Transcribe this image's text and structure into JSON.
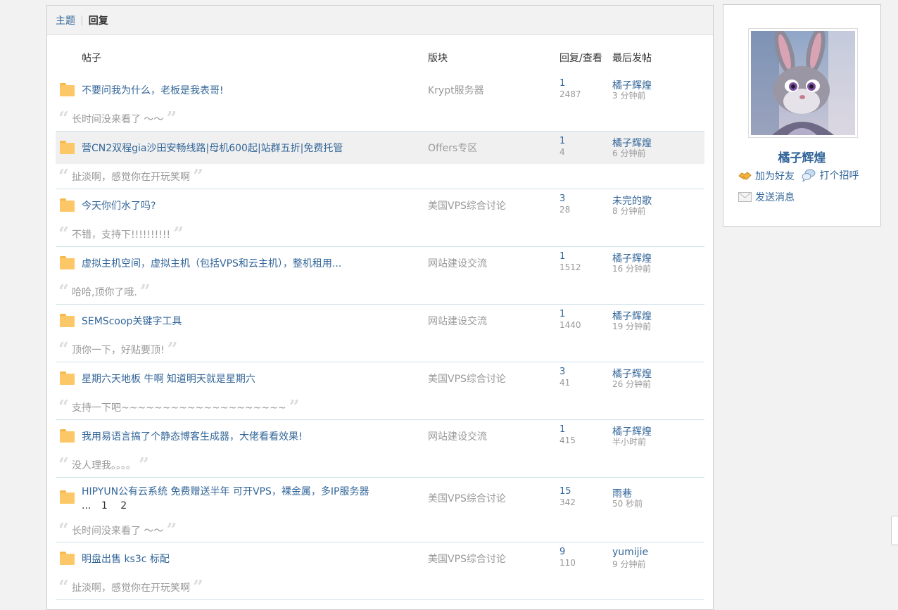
{
  "tabs": {
    "topics": "主题",
    "separator": "|",
    "replies": "回复"
  },
  "header": {
    "post": "帖子",
    "forum": "版块",
    "stats": "回复/查看",
    "last": "最后发帖"
  },
  "threads": [
    {
      "title": "不要问我为什么，老板是我表哥!",
      "forum": "Krypt服务器",
      "replies": "1",
      "views": "2487",
      "last_user": "橘子辉煌",
      "last_time": "3 分钟前",
      "quote": "长时间没来看了 ～～"
    },
    {
      "title": "营CN2双程gia沙田安畅线路|母机600起|站群五折|免费托管",
      "forum": "Offers专区",
      "replies": "1",
      "views": "4",
      "last_user": "橘子辉煌",
      "last_time": "6 分钟前",
      "quote": "扯淡啊，感觉你在开玩笑啊"
    },
    {
      "title": "今天你们水了吗?",
      "forum": "美国VPS综合讨论",
      "replies": "3",
      "views": "28",
      "last_user": "未完的歌",
      "last_time": "8 分钟前",
      "quote": "不错，支持下!!!!!!!!!!"
    },
    {
      "title": "虚拟主机空间，虚拟主机（包括VPS和云主机），整机租用...",
      "forum": "网站建设交流",
      "replies": "1",
      "views": "1512",
      "last_user": "橘子辉煌",
      "last_time": "16 分钟前",
      "quote": "哈哈,顶你了哦."
    },
    {
      "title": "SEMScoop关键字工具",
      "forum": "网站建设交流",
      "replies": "1",
      "views": "1440",
      "last_user": "橘子辉煌",
      "last_time": "19 分钟前",
      "quote": "顶你一下，好贴要顶!"
    },
    {
      "title": "星期六天地板 牛啊 知道明天就是星期六",
      "forum": "美国VPS综合讨论",
      "replies": "3",
      "views": "41",
      "last_user": "橘子辉煌",
      "last_time": "26 分钟前",
      "quote": "支持一下吧~~~~~~~~~~~~~~~~~~~~"
    },
    {
      "title": "我用易语言搞了个静态博客生成器，大佬看看效果!",
      "forum": "网站建设交流",
      "replies": "1",
      "views": "415",
      "last_user": "橘子辉煌",
      "last_time": "半小时前",
      "quote": "没人理我。。。。"
    },
    {
      "title": "HIPYUN公有云系统 免费赠送半年 可开VPS，裸金属，多IP服务器",
      "pages": [
        "...",
        "1",
        "2"
      ],
      "forum": "美国VPS综合讨论",
      "replies": "15",
      "views": "342",
      "last_user": "雨巷",
      "last_time": "50 秒前",
      "quote": "长时间没来看了 ～～"
    },
    {
      "title": "明盘出售 ks3c 标配",
      "forum": "美国VPS综合讨论",
      "replies": "9",
      "views": "110",
      "last_user": "yumijie",
      "last_time": "9 分钟前",
      "quote": "扯淡啊，感觉你在开玩笑啊"
    }
  ],
  "profile": {
    "name": "橘子辉煌",
    "add_friend": "加为好友",
    "greet": "打个招呼",
    "message": "发送消息"
  },
  "icons": {
    "folder": "folder-icon",
    "add_friend": "handshake-icon",
    "greet": "chat-bubble-icon",
    "message": "envelope-icon"
  },
  "colors": {
    "link": "#336699",
    "muted": "#999999",
    "folder": "#fcc867",
    "divider": "#cfe3e8"
  }
}
